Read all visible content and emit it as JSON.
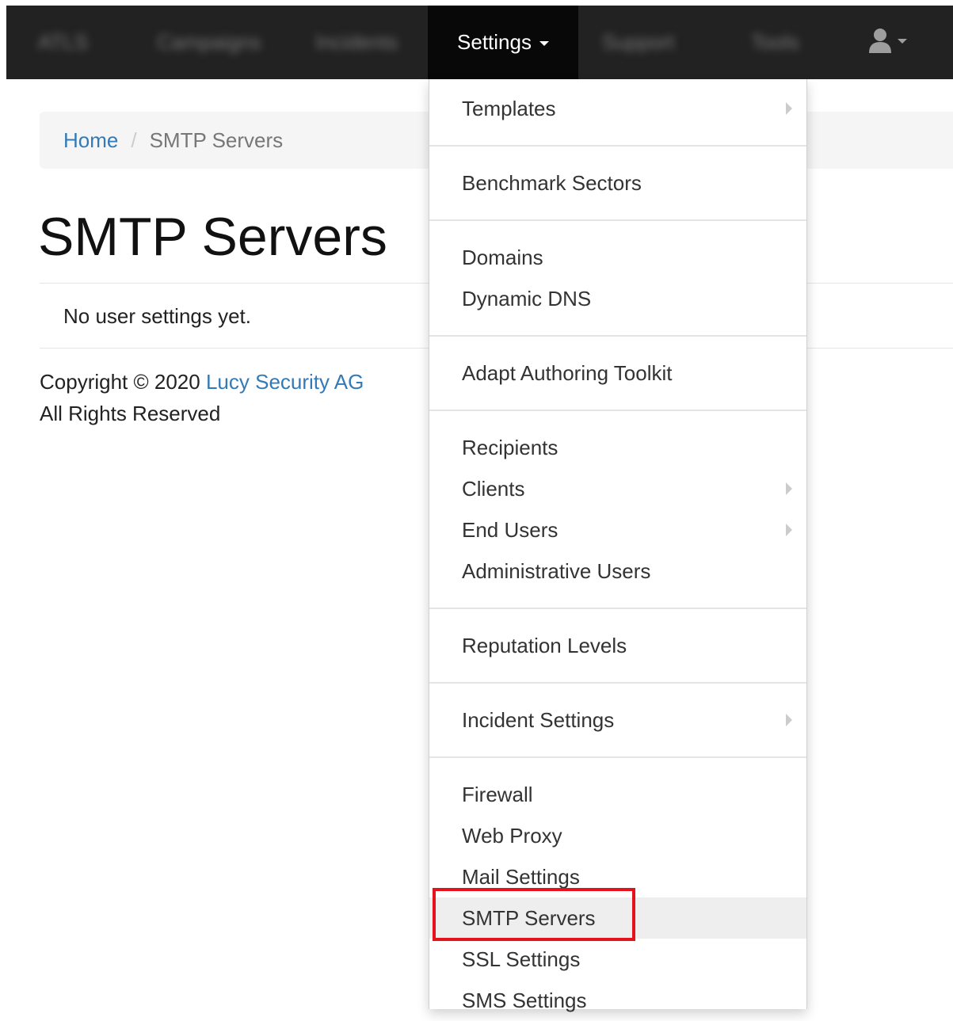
{
  "navbar": {
    "brand": "ATLS",
    "items": [
      {
        "label": "Campaigns"
      },
      {
        "label": "Incidents"
      },
      {
        "label": "Settings"
      },
      {
        "label": "Support"
      },
      {
        "label": "Tools"
      }
    ]
  },
  "breadcrumb": {
    "home": "Home",
    "separator": "/",
    "current": "SMTP Servers"
  },
  "page": {
    "title": "SMTP Servers",
    "empty_message": "No user settings yet."
  },
  "footer": {
    "copyright_prefix": "Copyright © 2020 ",
    "company": "Lucy Security AG",
    "rights": "All Rights Reserved"
  },
  "dropdown": {
    "items": [
      {
        "label": "Templates"
      },
      {
        "label": "Benchmark Sectors"
      },
      {
        "label": "Domains"
      },
      {
        "label": "Dynamic DNS"
      },
      {
        "label": "Adapt Authoring Toolkit"
      },
      {
        "label": "Recipients"
      },
      {
        "label": "Clients"
      },
      {
        "label": "End Users"
      },
      {
        "label": "Administrative Users"
      },
      {
        "label": "Reputation Levels"
      },
      {
        "label": "Incident Settings"
      },
      {
        "label": "Firewall"
      },
      {
        "label": "Web Proxy"
      },
      {
        "label": "Mail Settings"
      },
      {
        "label": "SMTP Servers"
      },
      {
        "label": "SSL Settings"
      },
      {
        "label": "SMS Settings"
      }
    ]
  },
  "colors": {
    "navbar": "#222222",
    "link": "#337ab7",
    "highlight": "#e3121b"
  }
}
